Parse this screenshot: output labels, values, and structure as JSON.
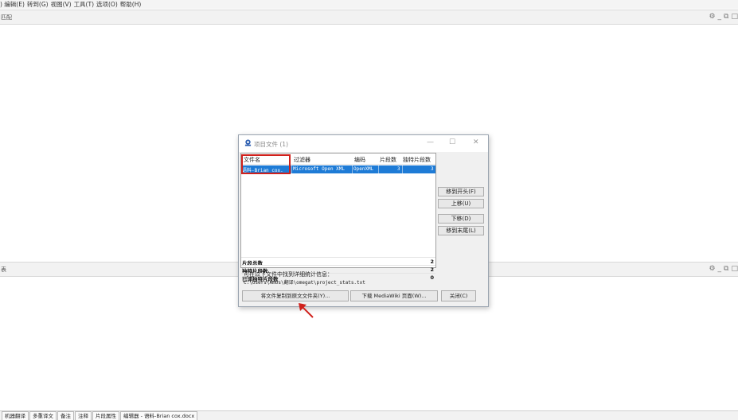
{
  "menubar": {
    "items": [
      ") 编辑(E)",
      "转到(G)",
      "视图(V)",
      "工具(T)",
      "选项(O)",
      "帮助(H)"
    ]
  },
  "top_pane": {
    "title": "匹配"
  },
  "bottom_pane": {
    "title": "表"
  },
  "pane_controls": {
    "settings": "⚙",
    "minimize": "_",
    "undock": "⧉",
    "maximize": "□"
  },
  "dialog": {
    "title": "项目文件 (1)",
    "window_controls": {
      "minimize": "—",
      "maximize": "☐",
      "close": "✕"
    },
    "table": {
      "headers": [
        "文件名",
        "过滤器",
        "编码",
        "片段数",
        "独特片段数"
      ],
      "rows": [
        {
          "filename": "语料-Brian cox.",
          "filter": "Microsoft Open XML",
          "encoding": "OpenXML",
          "segments": "3",
          "unique": "3"
        }
      ]
    },
    "summary": [
      {
        "label": "片段总数",
        "value": "2"
      },
      {
        "label": "独特片段数",
        "value": "2"
      },
      {
        "label": "已译独特片段数",
        "value": "0"
      }
    ],
    "side_buttons": {
      "move_top": "移到开头(F)",
      "move_up": "上移(U)",
      "move_down": "下移(D)",
      "move_bottom": "移到末尾(L)"
    },
    "info_line": "可在以下文件中找到详细统计信息：",
    "stats_path": "C:\\Users\\Amos\\翻译\\omegat\\project_stats.txt",
    "bottom_buttons": {
      "copy_to_source": "将文件复制到原文文件夹(Y)...",
      "download_mediawiki": "下载 MediaWiki 页面(W)...",
      "close": "关闭(C)"
    }
  },
  "status_tabs": [
    "机器翻译",
    "多重译文",
    "备注",
    "注释",
    "片段属性",
    "编辑器 - 语料-Brian cox.docx"
  ],
  "colors": {
    "selection": "#1e7bd6",
    "highlight_box": "#d0211c",
    "arrow": "#d0211c"
  }
}
